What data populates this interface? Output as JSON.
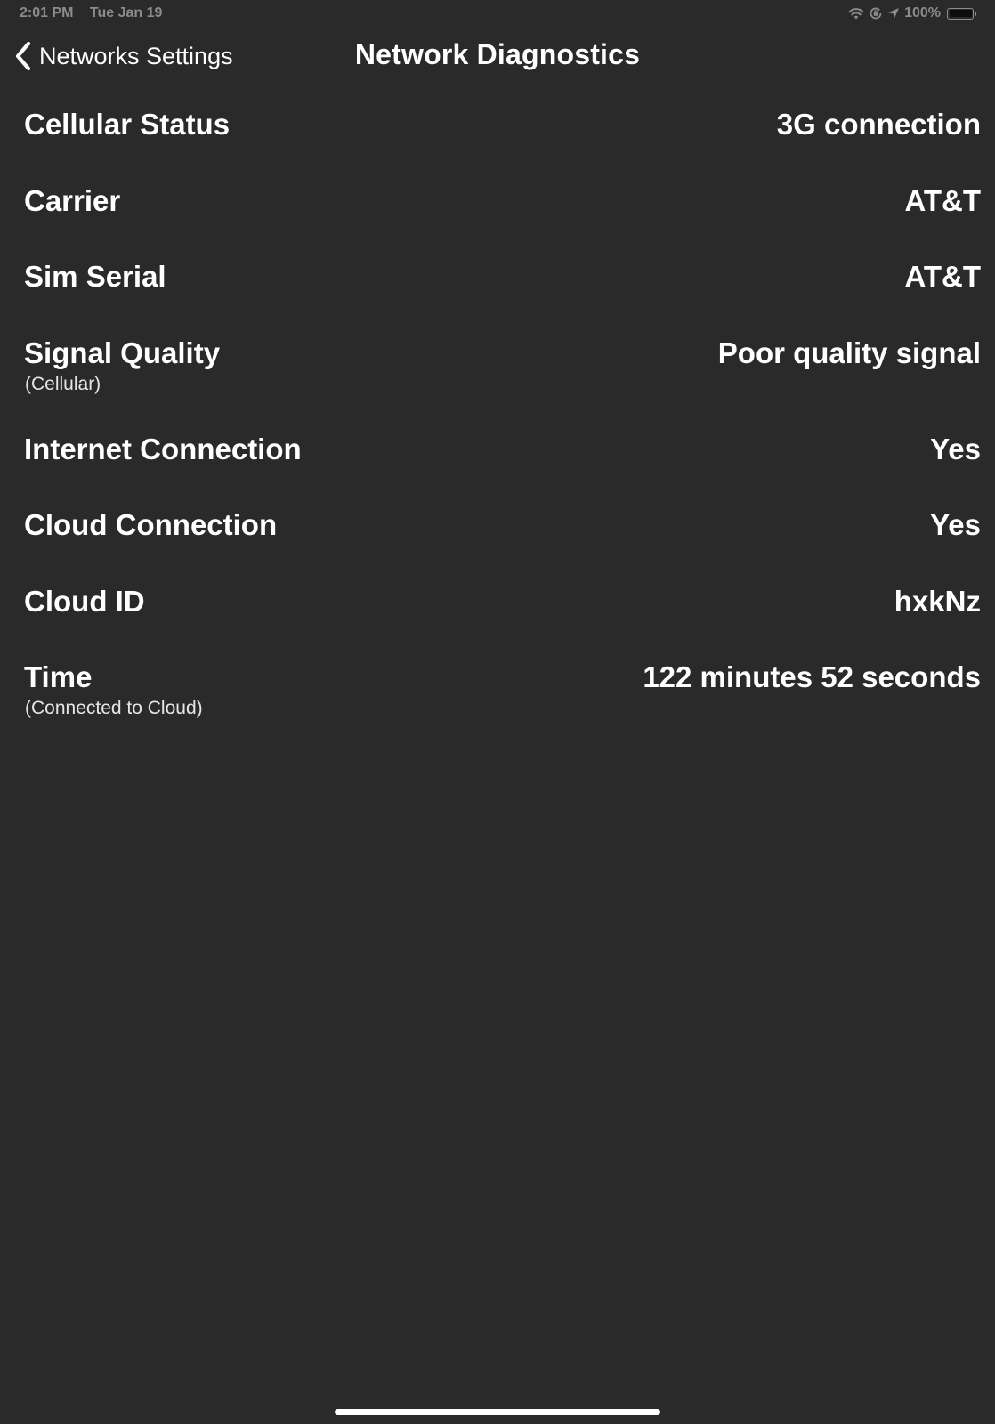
{
  "status_bar": {
    "time": "2:01 PM",
    "date": "Tue Jan 19",
    "battery_text": "100%",
    "battery_level": 1.0,
    "icons": [
      "wifi-icon",
      "screen-lock-rotation-icon",
      "location-arrow-icon",
      "battery-icon"
    ]
  },
  "nav": {
    "back_label": "Networks Settings",
    "back_icon": "chevron-left-icon",
    "title": "Network Diagnostics"
  },
  "rows": [
    {
      "label": "Cellular Status",
      "sublabel": "",
      "value": "3G connection"
    },
    {
      "label": "Carrier",
      "sublabel": "",
      "value": "AT&T"
    },
    {
      "label": "Sim Serial",
      "sublabel": "",
      "value": "AT&T"
    },
    {
      "label": "Signal Quality",
      "sublabel": "(Cellular)",
      "value": "Poor quality signal"
    },
    {
      "label": "Internet Connection",
      "sublabel": "",
      "value": "Yes"
    },
    {
      "label": "Cloud Connection",
      "sublabel": "",
      "value": "Yes"
    },
    {
      "label": "Cloud ID",
      "sublabel": "",
      "value": "hxkNz"
    },
    {
      "label": "Time",
      "sublabel": "(Connected to Cloud)",
      "value": "122 minutes 52 seconds"
    }
  ],
  "colors": {
    "background": "#2a2a2b",
    "text": "#ffffff",
    "status_text": "#8c8c8c"
  }
}
